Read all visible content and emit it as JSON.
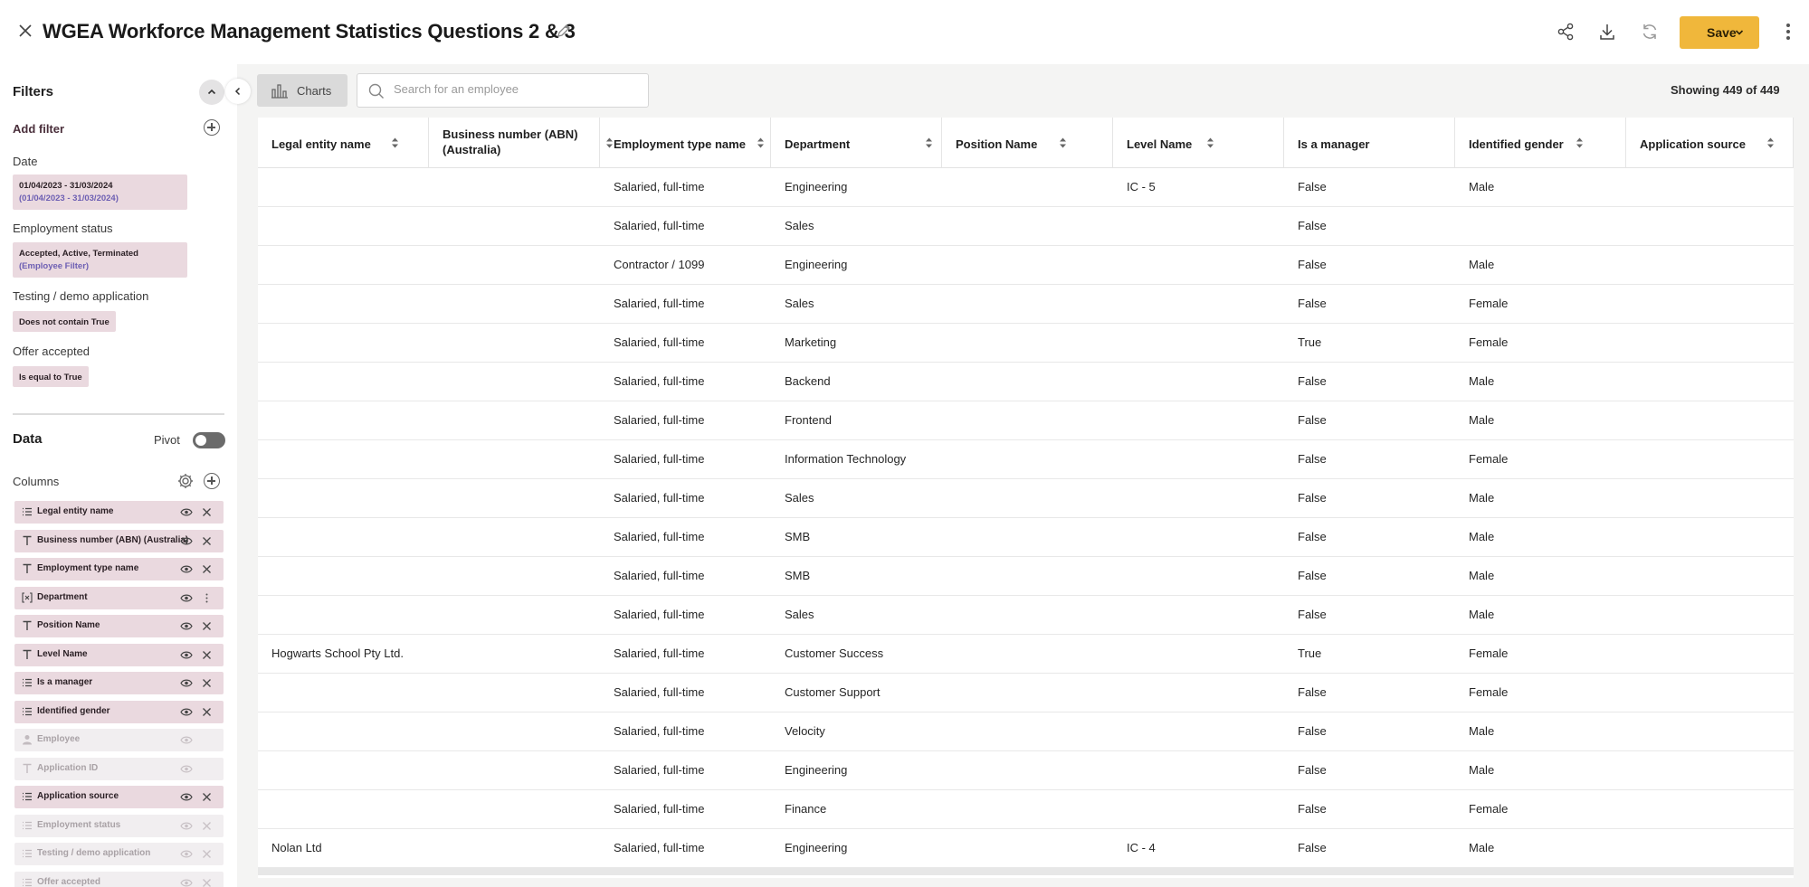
{
  "header": {
    "title": "WGEA Workforce Management Statistics Questions 2 & 3",
    "save_label": "Save"
  },
  "filters": {
    "title": "Filters",
    "add_filter_label": "Add filter",
    "groups": [
      {
        "label": "Date",
        "chip_main": "01/04/2023 - 31/03/2024",
        "chip_sub": "(01/04/2023 - 31/03/2024)"
      },
      {
        "label": "Employment status",
        "chip_main": "Accepted, Active, Terminated",
        "chip_sub": "(Employee Filter)"
      },
      {
        "label": "Testing / demo application",
        "chip_main": "Does not contain True",
        "chip_sub": ""
      },
      {
        "label": "Offer accepted",
        "chip_main": "Is equal to True",
        "chip_sub": ""
      }
    ]
  },
  "data_panel": {
    "title": "Data",
    "pivot_label": "Pivot",
    "columns_label": "Columns",
    "columns": [
      {
        "label": "Legal entity name",
        "icon": "list-icon",
        "active": true,
        "action": "remove"
      },
      {
        "label": "Business number (ABN) (Australia)",
        "icon": "text-icon",
        "active": true,
        "action": "remove"
      },
      {
        "label": "Employment type name",
        "icon": "text-icon",
        "active": true,
        "action": "remove"
      },
      {
        "label": "Department",
        "icon": "formula-icon",
        "active": true,
        "action": "more"
      },
      {
        "label": "Position Name",
        "icon": "text-icon",
        "active": true,
        "action": "remove"
      },
      {
        "label": "Level Name",
        "icon": "text-icon",
        "active": true,
        "action": "remove"
      },
      {
        "label": "Is a manager",
        "icon": "list-icon",
        "active": true,
        "action": "remove"
      },
      {
        "label": "Identified gender",
        "icon": "list-icon",
        "active": true,
        "action": "remove"
      },
      {
        "label": "Employee",
        "icon": "person-icon",
        "active": false,
        "action": "none"
      },
      {
        "label": "Application ID",
        "icon": "text-icon",
        "active": false,
        "action": "none"
      },
      {
        "label": "Application source",
        "icon": "list-icon",
        "active": true,
        "action": "remove"
      },
      {
        "label": "Employment status",
        "icon": "list-icon",
        "active": false,
        "action": "remove"
      },
      {
        "label": "Testing / demo application",
        "icon": "list-icon",
        "active": false,
        "action": "remove"
      },
      {
        "label": "Offer accepted",
        "icon": "list-icon",
        "active": false,
        "action": "remove"
      }
    ]
  },
  "toolbar": {
    "charts_label": "Charts",
    "search_placeholder": "Search for an employee",
    "showing_text": "Showing 449 of 449"
  },
  "table": {
    "headers": [
      "Legal entity name",
      "Business number (ABN) (Australia)",
      "Employment type name",
      "Department",
      "Position Name",
      "Level Name",
      "Is a manager",
      "Identified gender",
      "Application source"
    ],
    "rows": [
      [
        "",
        "",
        "Salaried, full-time",
        "Engineering",
        "",
        "IC - 5",
        "False",
        "Male",
        ""
      ],
      [
        "",
        "",
        "Salaried, full-time",
        "Sales",
        "",
        "",
        "False",
        "",
        ""
      ],
      [
        "",
        "",
        "Contractor / 1099",
        "Engineering",
        "",
        "",
        "False",
        "Male",
        ""
      ],
      [
        "",
        "",
        "Salaried, full-time",
        "Sales",
        "",
        "",
        "False",
        "Female",
        ""
      ],
      [
        "",
        "",
        "Salaried, full-time",
        "Marketing",
        "",
        "",
        "True",
        "Female",
        ""
      ],
      [
        "",
        "",
        "Salaried, full-time",
        "Backend",
        "",
        "",
        "False",
        "Male",
        ""
      ],
      [
        "",
        "",
        "Salaried, full-time",
        "Frontend",
        "",
        "",
        "False",
        "Male",
        ""
      ],
      [
        "",
        "",
        "Salaried, full-time",
        "Information Technology",
        "",
        "",
        "False",
        "Female",
        ""
      ],
      [
        "",
        "",
        "Salaried, full-time",
        "Sales",
        "",
        "",
        "False",
        "Male",
        ""
      ],
      [
        "",
        "",
        "Salaried, full-time",
        "SMB",
        "",
        "",
        "False",
        "Male",
        ""
      ],
      [
        "",
        "",
        "Salaried, full-time",
        "SMB",
        "",
        "",
        "False",
        "Male",
        ""
      ],
      [
        "",
        "",
        "Salaried, full-time",
        "Sales",
        "",
        "",
        "False",
        "Male",
        ""
      ],
      [
        "Hogwarts School Pty Ltd.",
        "",
        "Salaried, full-time",
        "Customer Success",
        "",
        "",
        "True",
        "Female",
        ""
      ],
      [
        "",
        "",
        "Salaried, full-time",
        "Customer Support",
        "",
        "",
        "False",
        "Female",
        ""
      ],
      [
        "",
        "",
        "Salaried, full-time",
        "Velocity",
        "",
        "",
        "False",
        "Male",
        ""
      ],
      [
        "",
        "",
        "Salaried, full-time",
        "Engineering",
        "",
        "",
        "False",
        "Male",
        ""
      ],
      [
        "",
        "",
        "Salaried, full-time",
        "Finance",
        "",
        "",
        "False",
        "Female",
        ""
      ],
      [
        "Nolan Ltd",
        "",
        "Salaried, full-time",
        "Engineering",
        "",
        "IC - 4",
        "False",
        "Male",
        ""
      ]
    ]
  },
  "colors": {
    "accent": "#f0b73b",
    "chip_bg": "#ead9df",
    "chip_sub_text": "#6d5fb3"
  }
}
